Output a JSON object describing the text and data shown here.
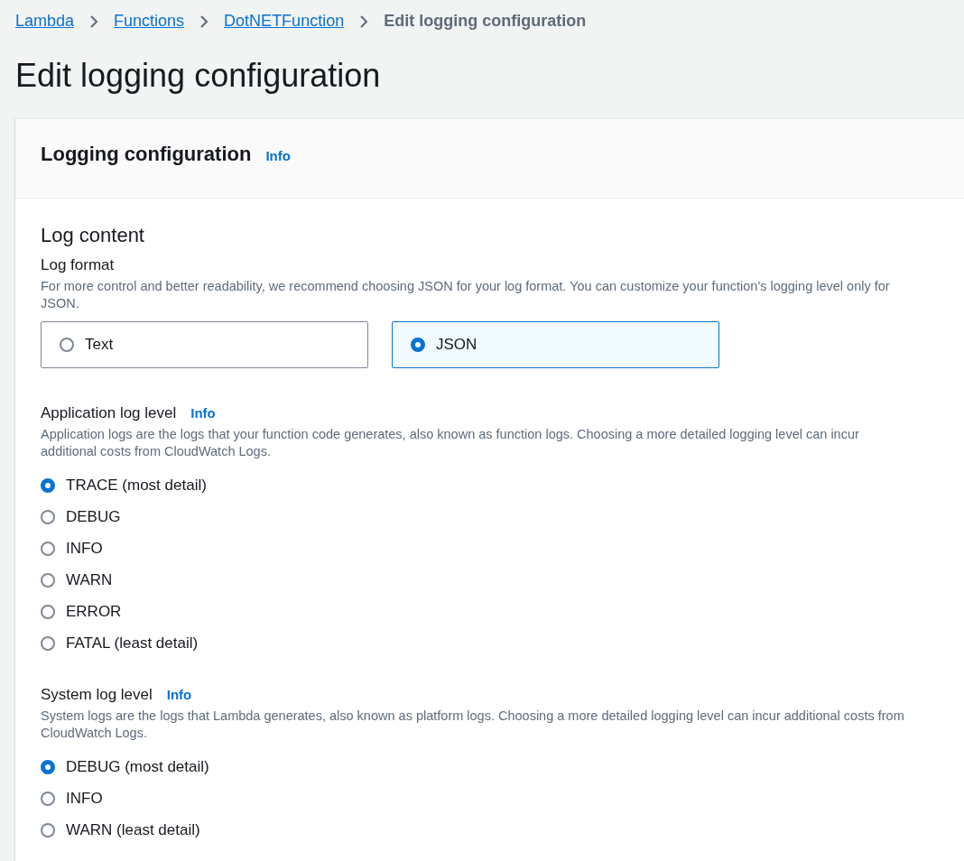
{
  "breadcrumbs": [
    {
      "label": "Lambda",
      "kind": "link"
    },
    {
      "label": "Functions",
      "kind": "link"
    },
    {
      "label": "DotNETFunction",
      "kind": "link"
    },
    {
      "label": "Edit logging configuration",
      "kind": "current"
    }
  ],
  "page_title": "Edit logging configuration",
  "panel": {
    "title": "Logging configuration",
    "info": "Info",
    "section_title": "Log content",
    "log_format": {
      "label": "Log format",
      "description": "For more control and better readability, we recommend choosing JSON for your log format. You can customize your function's logging level only for JSON.",
      "options": [
        {
          "label": "Text",
          "selected": false
        },
        {
          "label": "JSON",
          "selected": true
        }
      ]
    },
    "groups": [
      {
        "label": "Application log level",
        "info": "Info",
        "description": "Application logs are the logs that your function code generates, also known as function logs. Choosing a more detailed logging level can incur additional costs from CloudWatch Logs.",
        "options": [
          {
            "label": "TRACE (most detail)",
            "selected": true
          },
          {
            "label": "DEBUG",
            "selected": false
          },
          {
            "label": "INFO",
            "selected": false
          },
          {
            "label": "WARN",
            "selected": false
          },
          {
            "label": "ERROR",
            "selected": false
          },
          {
            "label": "FATAL (least detail)",
            "selected": false
          }
        ]
      },
      {
        "label": "System log level",
        "info": "Info",
        "description": "System logs are the logs that Lambda generates, also known as platform logs. Choosing a more detailed logging level can incur additional costs from CloudWatch Logs.",
        "options": [
          {
            "label": "DEBUG (most detail)",
            "selected": true
          },
          {
            "label": "INFO",
            "selected": false
          },
          {
            "label": "WARN (least detail)",
            "selected": false
          }
        ]
      }
    ]
  }
}
